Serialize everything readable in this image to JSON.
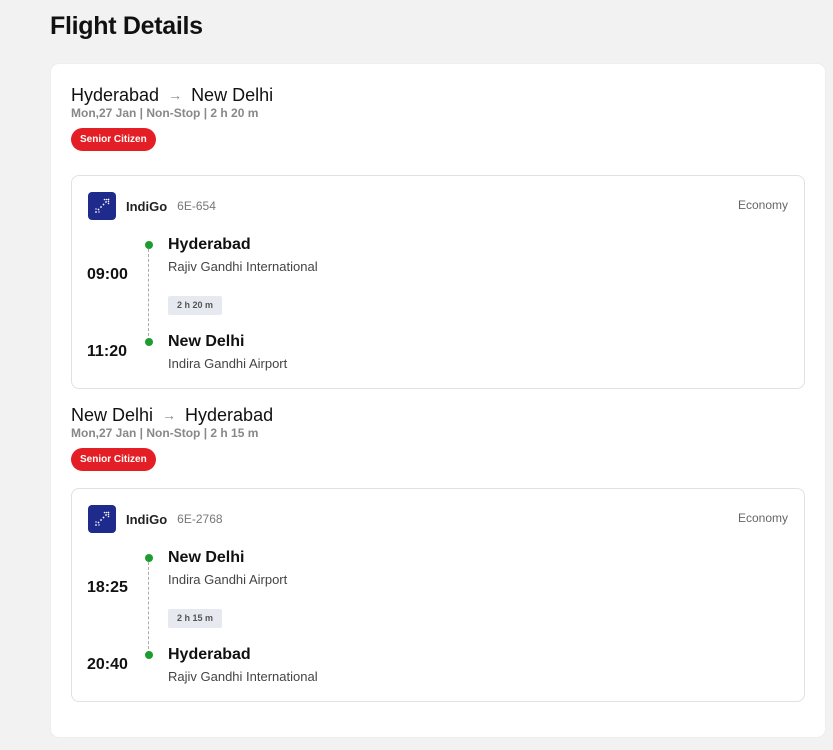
{
  "page": {
    "title": "Flight Details"
  },
  "colors": {
    "badge": "#e31e24",
    "dot": "#1d9c2f",
    "airline_logo": "#1e2a8c"
  },
  "journeys": [
    {
      "from": "Hyderabad",
      "to": "New Delhi",
      "arrow": "→",
      "info": "Mon,27 Jan | Non-Stop | 2 h 20 m",
      "badge": "Senior Citizen",
      "leg": {
        "airline": "IndiGo",
        "airline_icon": "indigo-logo-icon",
        "flight_no": "6E-654",
        "cabin": "Economy",
        "dep_time": "09:00",
        "dep_city": "Hyderabad",
        "dep_airport": "Rajiv Gandhi International",
        "duration": "2 h 20 m",
        "arr_time": "11:20",
        "arr_city": "New Delhi",
        "arr_airport": "Indira Gandhi Airport"
      }
    },
    {
      "from": "New Delhi",
      "to": "Hyderabad",
      "arrow": "→",
      "info": "Mon,27 Jan | Non-Stop | 2 h 15 m",
      "badge": "Senior Citizen",
      "leg": {
        "airline": "IndiGo",
        "airline_icon": "indigo-logo-icon",
        "flight_no": "6E-2768",
        "cabin": "Economy",
        "dep_time": "18:25",
        "dep_city": "New Delhi",
        "dep_airport": "Indira Gandhi Airport",
        "duration": "2 h 15 m",
        "arr_time": "20:40",
        "arr_city": "Hyderabad",
        "arr_airport": "Rajiv Gandhi International"
      }
    }
  ]
}
